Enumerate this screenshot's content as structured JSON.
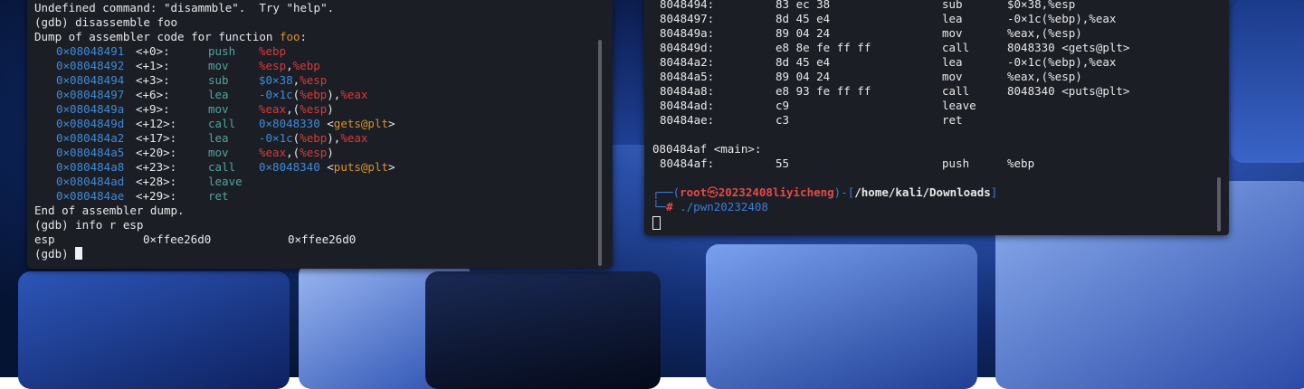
{
  "left_terminal": {
    "line_undef": "Undefined command: \"disammble\".  Try \"help\".",
    "cmd_disassemble": "(gdb) disassemble foo",
    "dump_prefix": "Dump of assembler code for function ",
    "dump_func": "foo",
    "dump_suffix": ":",
    "asm": [
      {
        "addr": "0×08048491",
        "off": "<+0>:",
        "op": "push",
        "args": [
          {
            "t": "%ebp",
            "c": "reg"
          }
        ]
      },
      {
        "addr": "0×08048492",
        "off": "<+1>:",
        "op": "mov",
        "args": [
          {
            "t": "%esp",
            "c": "reg"
          },
          {
            "t": ",",
            "c": "white"
          },
          {
            "t": "%ebp",
            "c": "reg"
          }
        ]
      },
      {
        "addr": "0×08048494",
        "off": "<+3>:",
        "op": "sub",
        "args": [
          {
            "t": "$0×38",
            "c": "num"
          },
          {
            "t": ",",
            "c": "white"
          },
          {
            "t": "%esp",
            "c": "reg"
          }
        ]
      },
      {
        "addr": "0×08048497",
        "off": "<+6>:",
        "op": "lea",
        "args": [
          {
            "t": "-0×1c",
            "c": "num"
          },
          {
            "t": "(",
            "c": "white"
          },
          {
            "t": "%ebp",
            "c": "reg"
          },
          {
            "t": "),",
            "c": "white"
          },
          {
            "t": "%eax",
            "c": "reg"
          }
        ]
      },
      {
        "addr": "0×0804849a",
        "off": "<+9>:",
        "op": "mov",
        "args": [
          {
            "t": "%eax",
            "c": "reg"
          },
          {
            "t": ",(",
            "c": "white"
          },
          {
            "t": "%esp",
            "c": "reg"
          },
          {
            "t": ")",
            "c": "white"
          }
        ]
      },
      {
        "addr": "0×0804849d",
        "off": "<+12>:",
        "op": "call",
        "args": [
          {
            "t": "0×8048330",
            "c": "num"
          },
          {
            "t": " <",
            "c": "white"
          },
          {
            "t": "gets@plt",
            "c": "func"
          },
          {
            "t": ">",
            "c": "white"
          }
        ]
      },
      {
        "addr": "0×080484a2",
        "off": "<+17>:",
        "op": "lea",
        "args": [
          {
            "t": "-0×1c",
            "c": "num"
          },
          {
            "t": "(",
            "c": "white"
          },
          {
            "t": "%ebp",
            "c": "reg"
          },
          {
            "t": "),",
            "c": "white"
          },
          {
            "t": "%eax",
            "c": "reg"
          }
        ]
      },
      {
        "addr": "0×080484a5",
        "off": "<+20>:",
        "op": "mov",
        "args": [
          {
            "t": "%eax",
            "c": "reg"
          },
          {
            "t": ",(",
            "c": "white"
          },
          {
            "t": "%esp",
            "c": "reg"
          },
          {
            "t": ")",
            "c": "white"
          }
        ]
      },
      {
        "addr": "0×080484a8",
        "off": "<+23>:",
        "op": "call",
        "args": [
          {
            "t": "0×8048340",
            "c": "num"
          },
          {
            "t": " <",
            "c": "white"
          },
          {
            "t": "puts@plt",
            "c": "func"
          },
          {
            "t": ">",
            "c": "white"
          }
        ]
      },
      {
        "addr": "0×080484ad",
        "off": "<+28>:",
        "op": "leave",
        "args": []
      },
      {
        "addr": "0×080484ae",
        "off": "<+29>:",
        "op": "ret",
        "args": []
      }
    ],
    "end_dump": "End of assembler dump.",
    "cmd_info": "(gdb) info r esp",
    "reg_name": "esp",
    "reg_hex": "0×ffee26d0",
    "reg_val": "0×ffee26d0",
    "prompt": "(gdb) "
  },
  "right_terminal": {
    "objdump": [
      {
        "addr": "8048494:",
        "bytes": "83 ec 38",
        "op": "sub",
        "args": "$0×38,%esp"
      },
      {
        "addr": "8048497:",
        "bytes": "8d 45 e4",
        "op": "lea",
        "args": "-0×1c(%ebp),%eax"
      },
      {
        "addr": "804849a:",
        "bytes": "89 04 24",
        "op": "mov",
        "args": "%eax,(%esp)"
      },
      {
        "addr": "804849d:",
        "bytes": "e8 8e fe ff ff",
        "op": "call",
        "args": "8048330 <gets@plt>"
      },
      {
        "addr": "80484a2:",
        "bytes": "8d 45 e4",
        "op": "lea",
        "args": "-0×1c(%ebp),%eax"
      },
      {
        "addr": "80484a5:",
        "bytes": "89 04 24",
        "op": "mov",
        "args": "%eax,(%esp)"
      },
      {
        "addr": "80484a8:",
        "bytes": "e8 93 fe ff ff",
        "op": "call",
        "args": "8048340 <puts@plt>"
      },
      {
        "addr": "80484ad:",
        "bytes": "c9",
        "op": "leave",
        "args": ""
      },
      {
        "addr": "80484ae:",
        "bytes": "c3",
        "op": "ret",
        "args": ""
      }
    ],
    "main_label": "080484af <main>:",
    "main_line": {
      "addr": "80484af:",
      "bytes": "55",
      "op": "push",
      "args": "%ebp"
    },
    "prompt_open": "(",
    "prompt_user": "root",
    "prompt_at": "㉿",
    "prompt_host": "20232408liyicheng",
    "prompt_mid": ")-[",
    "prompt_path": "/home/kali/Downloads",
    "prompt_close": "]",
    "hash": "#",
    "command": "./pwn20232408"
  }
}
